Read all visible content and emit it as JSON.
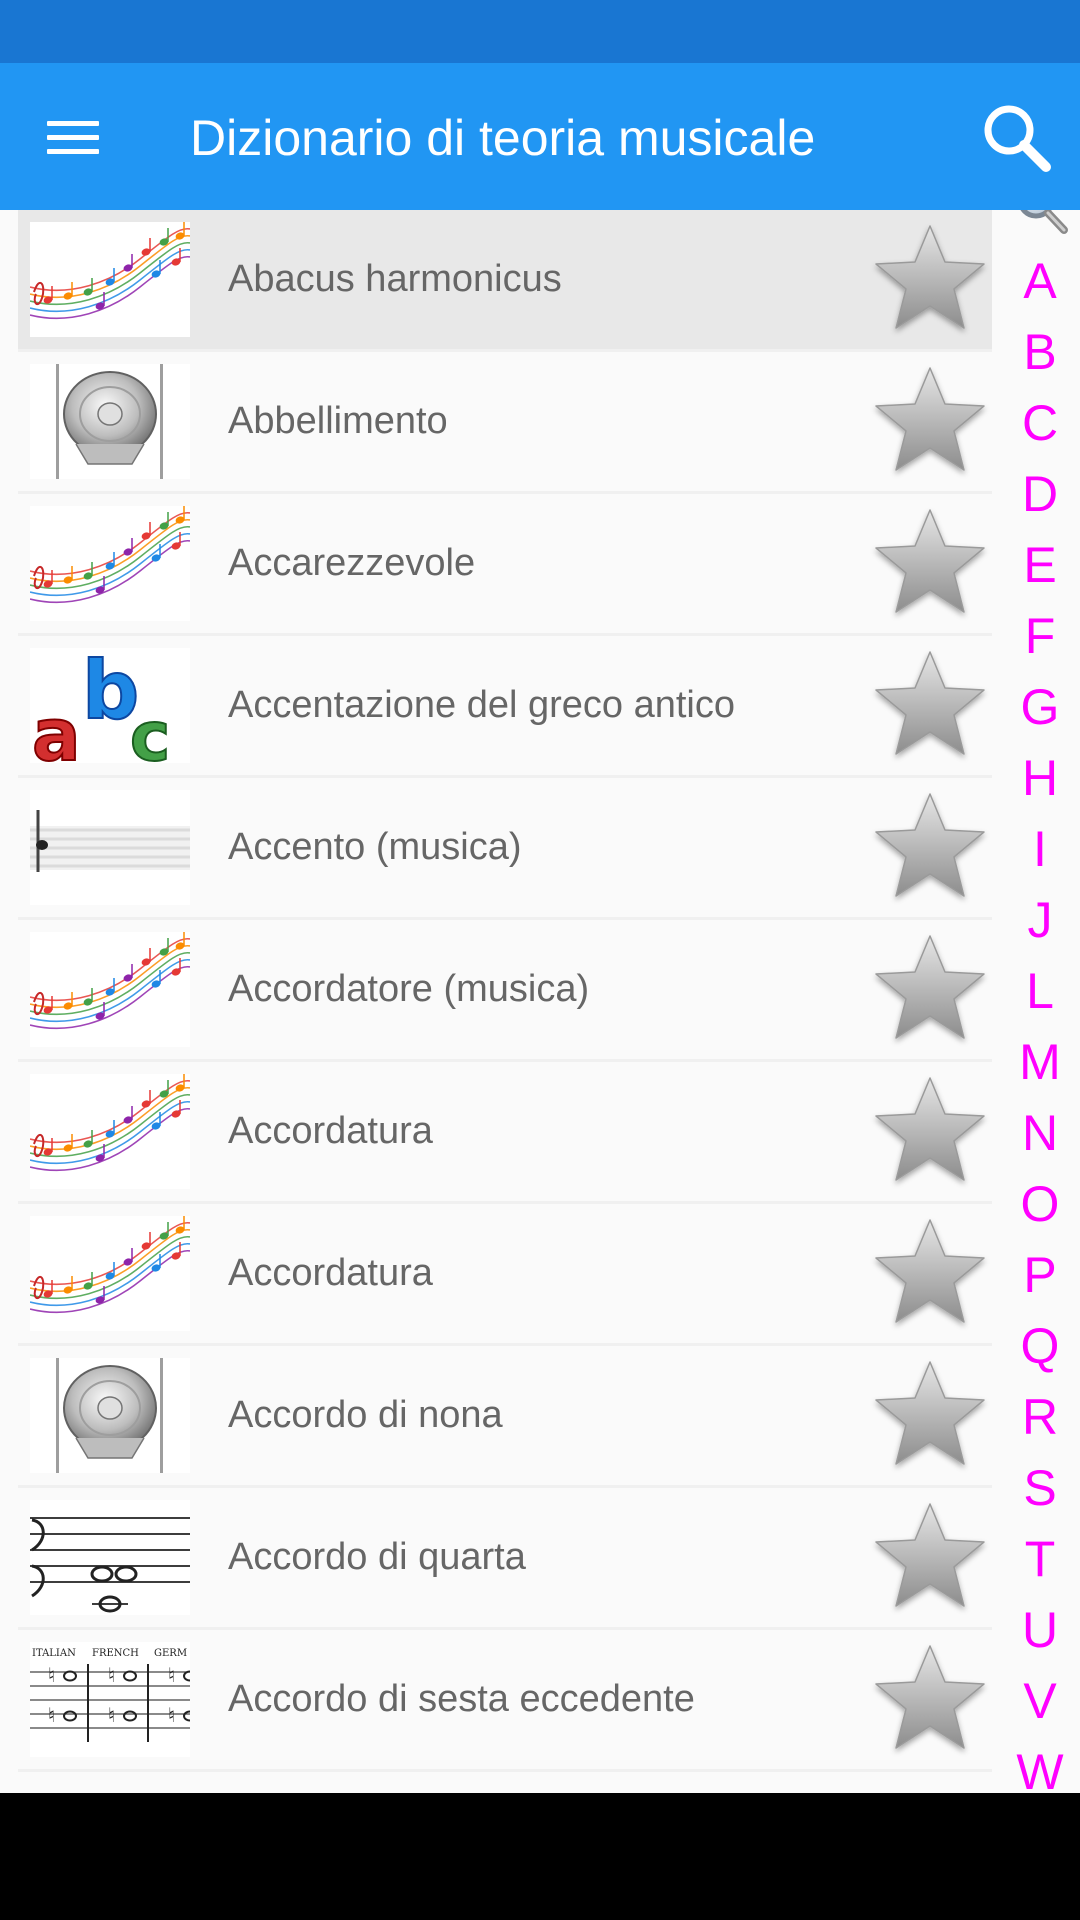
{
  "app_bar": {
    "title": "Dizionario di teoria musicale",
    "background_color": "#2196F3",
    "status_bar_color": "#1976D2",
    "menu_icon": "hamburger-menu-icon",
    "search_icon": "search-icon"
  },
  "list": {
    "items": [
      {
        "label": "Abacus harmonicus",
        "thumbnail": "music-staff-notes-icon",
        "favorite_icon": "star-icon",
        "selected": true
      },
      {
        "label": "Abbellimento",
        "thumbnail": "speaker-icon",
        "favorite_icon": "star-icon"
      },
      {
        "label": "Accarezzevole",
        "thumbnail": "music-staff-notes-icon",
        "favorite_icon": "star-icon"
      },
      {
        "label": "Accentazione del greco antico",
        "thumbnail": "abc-letters-icon",
        "favorite_icon": "star-icon"
      },
      {
        "label": "Accento (musica)",
        "thumbnail": "staff-accent-image",
        "favorite_icon": "star-icon"
      },
      {
        "label": "Accordatore (musica)",
        "thumbnail": "music-staff-notes-icon",
        "favorite_icon": "star-icon"
      },
      {
        "label": "Accordatura",
        "thumbnail": "music-staff-notes-icon",
        "favorite_icon": "star-icon"
      },
      {
        "label": "Accordatura",
        "thumbnail": "music-staff-notes-icon",
        "favorite_icon": "star-icon"
      },
      {
        "label": "Accordo di nona",
        "thumbnail": "speaker-icon",
        "favorite_icon": "star-icon"
      },
      {
        "label": "Accordo di quarta",
        "thumbnail": "bass-clef-chord-image",
        "favorite_icon": "star-icon"
      },
      {
        "label": "Accordo di sesta eccedente",
        "thumbnail": "augmented-sixth-chords-image",
        "favorite_icon": "star-icon"
      }
    ],
    "thumbnail_text": {
      "augmented_sixth": [
        "ITALIAN",
        "FRENCH",
        "GERM"
      ]
    }
  },
  "index_bar": {
    "search_icon": "magnifier-icon",
    "letter_color": "#FF00FF",
    "letters": [
      "A",
      "B",
      "C",
      "D",
      "E",
      "F",
      "G",
      "H",
      "I",
      "J",
      "L",
      "M",
      "N",
      "O",
      "P",
      "Q",
      "R",
      "S",
      "T",
      "U",
      "V",
      "W"
    ]
  }
}
